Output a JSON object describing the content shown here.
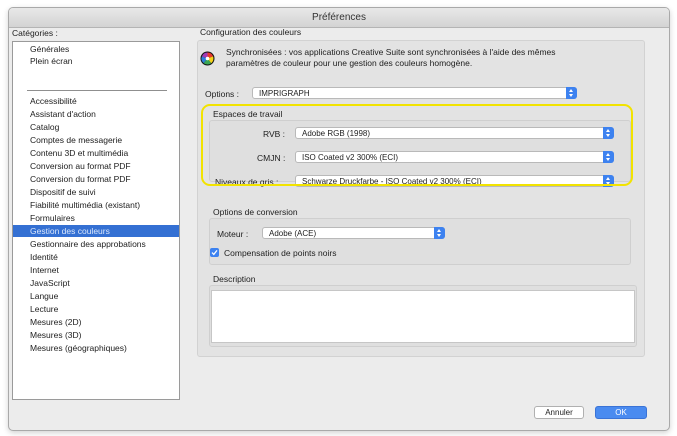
{
  "window": {
    "title": "Préférences"
  },
  "categories": {
    "label": "Catégories :",
    "group1": [
      "Générales",
      "Plein écran"
    ],
    "group2": [
      "Accessibilité",
      "Assistant d'action",
      "Catalog",
      "Comptes de messagerie",
      "Contenu 3D et multimédia",
      "Conversion au format PDF",
      "Conversion du format PDF",
      "Dispositif de suivi",
      "Fiabilité multimédia (existant)",
      "Formulaires",
      "Gestion des couleurs",
      "Gestionnaire des approbations",
      "Identité",
      "Internet",
      "JavaScript",
      "Langue",
      "Lecture",
      "Mesures (2D)",
      "Mesures (3D)",
      "Mesures (géographiques)"
    ],
    "selected": "Gestion des couleurs"
  },
  "color_settings": {
    "heading": "Configuration des couleurs",
    "sync_line1": "Synchronisées : vos applications Creative Suite sont synchronisées à l'aide des mêmes",
    "sync_line2": "paramètres de couleur pour une gestion des couleurs homogène.",
    "options_label": "Options :",
    "options_value": "IMPRIGRAPH"
  },
  "workspaces": {
    "title": "Espaces de travail",
    "rgb_label": "RVB :",
    "rgb_value": "Adobe RGB (1998)",
    "cmyk_label": "CMJN :",
    "cmyk_value": "ISO Coated v2 300% (ECI)",
    "gray_label": "Niveaux de gris :",
    "gray_value": "Schwarze Druckfarbe - ISO Coated v2 300% (ECI)"
  },
  "conversion": {
    "title": "Options de conversion",
    "engine_label": "Moteur :",
    "engine_value": "Adobe (ACE)",
    "black_point_label": "Compensation de points noirs",
    "black_point_checked": true
  },
  "description": {
    "title": "Description",
    "text": ""
  },
  "buttons": {
    "cancel": "Annuler",
    "ok": "OK"
  },
  "colors": {
    "accent": "#3d82f0",
    "selection": "#3470d3",
    "highlight": "#f2e300"
  }
}
